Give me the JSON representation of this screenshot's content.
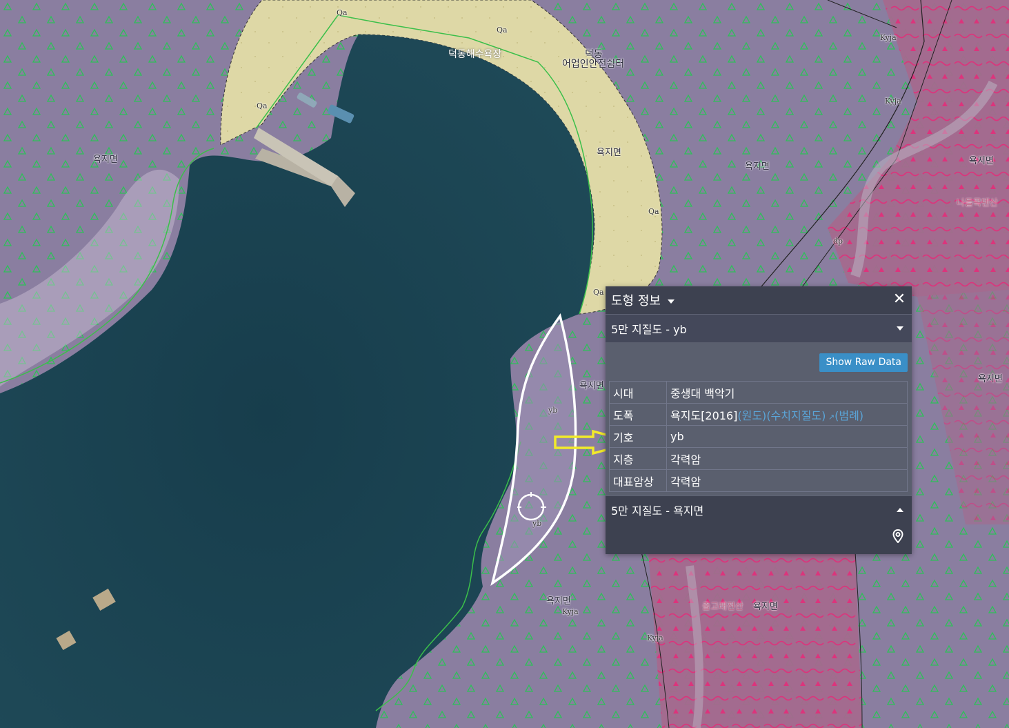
{
  "map": {
    "labels": {
      "beach": "덕동해수욕장",
      "center_1": "덕동",
      "center_2": "어업인안전쉼터",
      "town_1": "욕지면",
      "town_2": "욕지면",
      "town_3": "욕지면",
      "town_4": "욕지면",
      "town_5": "욕지면",
      "town_6": "욕지면",
      "town_7": "욕지면",
      "town_8": "욕지면",
      "road_1": "나들목덴산",
      "road_2": "출고래전산",
      "qa_1": "Qa",
      "qa_2": "Qa",
      "qa_3": "Qa",
      "qa_4": "Qa",
      "qa_5": "Qa",
      "kyja_1": "Kyja",
      "kyja_2": "Kyja",
      "kyja_3": "Kyja",
      "kyja_4": "Kyja",
      "dp": "dp",
      "yb_1": "yb",
      "yb_2": "yb"
    },
    "colors": {
      "sea": "#1e4656",
      "quaternary_fill": "#e8e2b0",
      "yb_fill": "#8a7ea0",
      "kyja_fill": "#a06a8a",
      "outline_green": "#3bbf4a",
      "arrow": "#f2ea2a",
      "selection": "#ffffff"
    }
  },
  "panel": {
    "title": "도형 정보",
    "close_glyph": "✕",
    "section1_title": "5만 지질도 - yb",
    "raw_button": "Show Raw Data",
    "rows": [
      {
        "key": "시대",
        "value": "중생대 백악기"
      },
      {
        "key": "도폭",
        "value": "욕지도[2016]"
      },
      {
        "key": "기호",
        "value": "yb"
      },
      {
        "key": "지층",
        "value": "각력암"
      },
      {
        "key": "대표암상",
        "value": "각력암"
      }
    ],
    "links": {
      "original": "(원도)",
      "digital": "(수치지질도)",
      "legend": "(범례)"
    },
    "section2_title": "5만 지질도 - 욕지면",
    "pin_icon": "map-pin-icon"
  }
}
